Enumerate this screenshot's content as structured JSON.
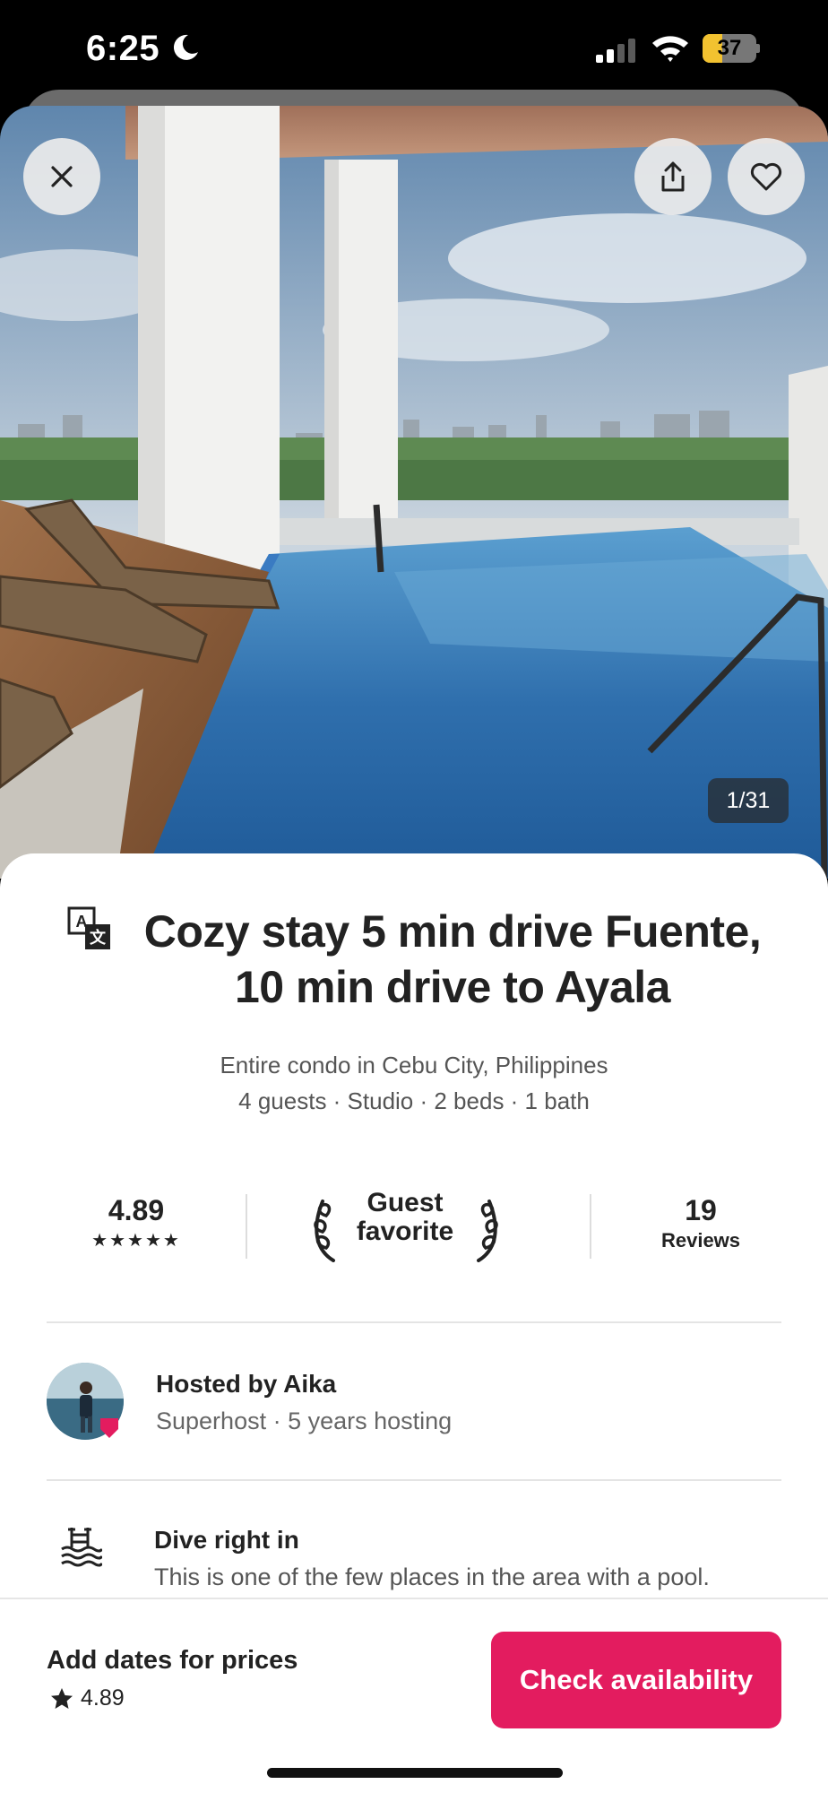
{
  "status_bar": {
    "time": "6:25",
    "battery": "37",
    "battery_level": 0.37
  },
  "gallery": {
    "counter": "1/31"
  },
  "listing": {
    "title": "Cozy stay 5 min drive Fuente, 10 min drive to Ayala",
    "type_location": "Entire condo in Cebu City, Philippines",
    "details": "4 guests · Studio · 2 beds · 1 bath"
  },
  "stats": {
    "rating": "4.89",
    "stars": "★★★★★",
    "badge_line1": "Guest",
    "badge_line2": "favorite",
    "reviews_count": "19",
    "reviews_label": "Reviews"
  },
  "host": {
    "title": "Hosted by Aika",
    "subtitle": "Superhost · 5 years hosting"
  },
  "highlight": {
    "icon": "pool-icon",
    "title": "Dive right in",
    "subtitle": "This is one of the few places in the area with a pool."
  },
  "footer": {
    "price_prompt": "Add dates for prices",
    "rating": "4.89",
    "cta_label": "Check availability",
    "cta_color": "#e31c5f"
  }
}
